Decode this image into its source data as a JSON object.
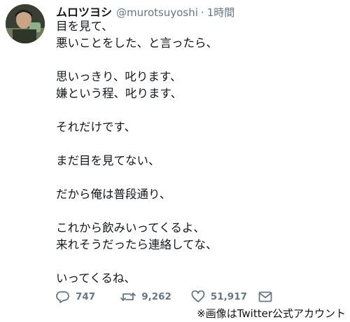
{
  "user": {
    "display_name": "ムロツヨシ",
    "handle": "@murotsuyoshi",
    "separator": "·",
    "time": "1時間"
  },
  "tweet_lines": [
    "目を見て、",
    "悪いことをした、と言ったら、",
    "",
    "思いっきり、叱ります、",
    "嫌という程、叱ります、",
    "",
    "それだけです、",
    "",
    "まだ目を見てない、",
    "",
    "だから俺は普段通り、",
    "",
    "これから飲みいってくるよ、",
    "来れそうだったら連絡してな、",
    "",
    "いってくるね、"
  ],
  "actions": {
    "reply_count": "747",
    "retweet_count": "9,262",
    "like_count": "51,917",
    "icons": [
      "reply-icon",
      "retweet-icon",
      "like-icon",
      "message-icon"
    ]
  },
  "credit": "※画像はTwitter公式アカウント",
  "colors": {
    "text": "#14171a",
    "secondary": "#657786",
    "background": "#ffffff"
  }
}
